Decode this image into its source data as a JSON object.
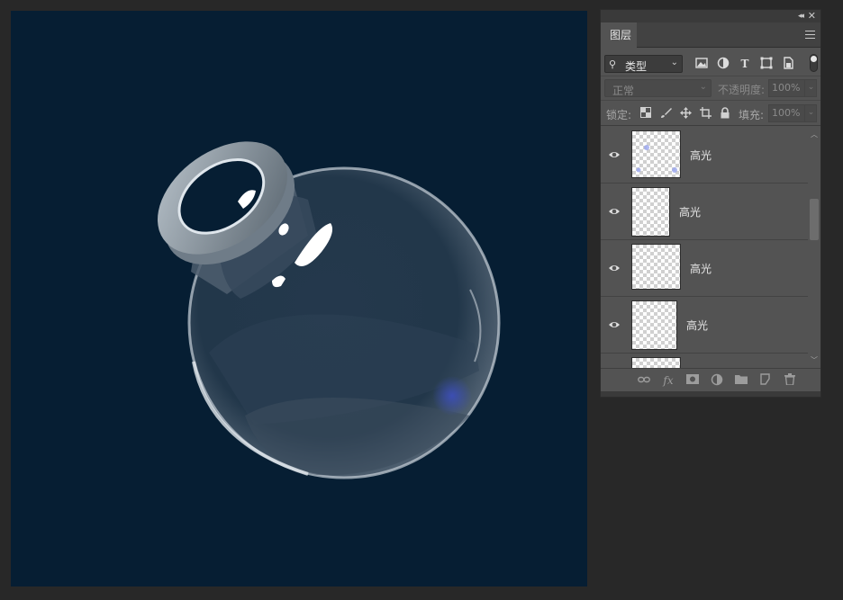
{
  "panel": {
    "tab_title": "图层",
    "collapse_glyph": "◂◂",
    "close_glyph": "✕"
  },
  "filter": {
    "kind_label": "类型",
    "icons": [
      "image-filter-icon",
      "adjustment-filter-icon",
      "type-filter-icon",
      "shape-filter-icon",
      "smart-object-filter-icon"
    ]
  },
  "blend": {
    "mode": "正常",
    "opacity_label": "不透明度:",
    "opacity_value": "100%"
  },
  "lock": {
    "label": "锁定:",
    "fill_label": "填充:",
    "fill_value": "100%"
  },
  "layers": [
    {
      "name": "高光",
      "visible": true
    },
    {
      "name": "高光",
      "visible": true
    },
    {
      "name": "高光",
      "visible": true
    },
    {
      "name": "高光",
      "visible": true
    }
  ],
  "colors": {
    "canvas_bg": "#061e33",
    "panel_bg": "#535353",
    "app_bg": "#282828"
  }
}
